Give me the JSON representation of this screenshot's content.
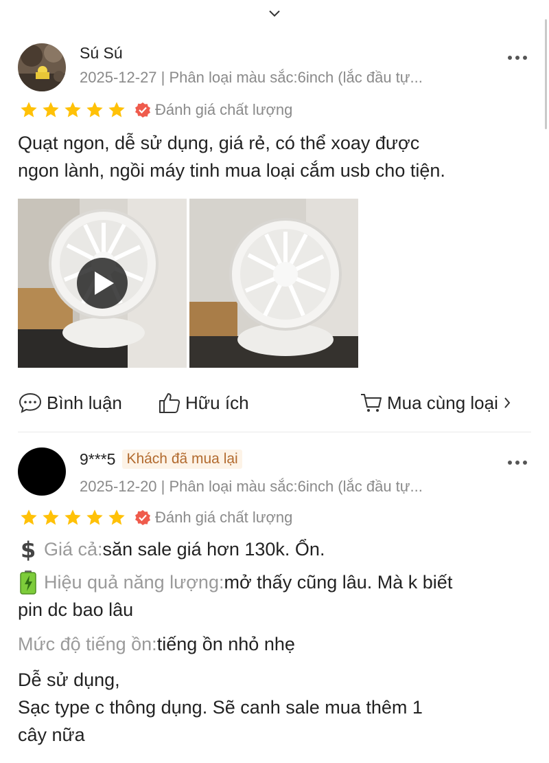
{
  "header": {
    "collapse_icon": "chevron-down-icon"
  },
  "reviews": [
    {
      "user": "Sú Sú",
      "date_variant": "2025-12-27 | Phân loại màu sắc:6inch (lắc đầu tự...",
      "stars": 5,
      "quality_badge": "Đánh giá chất lượng",
      "text_lines": [
        "Quạt ngon, dễ sử dụng, giá rẻ, có thể xoay được",
        "ngon lành, ngồi máy tinh mua loại cắm usb cho tiện."
      ],
      "media": [
        {
          "kind": "video",
          "icon": "play-icon"
        },
        {
          "kind": "photo"
        }
      ],
      "actions": {
        "comment": "Bình luận",
        "helpful": "Hữu ích",
        "buy_same": "Mua cùng loại"
      }
    },
    {
      "user": "9***5",
      "badge": "Khách đã mua lại",
      "date_variant": "2025-12-20 | Phân loại màu sắc:6inch (lắc đầu tự...",
      "stars": 5,
      "quality_badge": "Đánh giá chất lượng",
      "attributes": [
        {
          "icon": "dollar-icon",
          "label": "Giá cả:",
          "value": "săn sale giá hơn 130k. Ổn."
        },
        {
          "icon": "battery-icon",
          "label": "Hiệu quả năng lượng:",
          "value": "mở thấy cũng lâu. Mà k biết",
          "value_cont": "pin dc bao lâu"
        },
        {
          "label": "Mức độ tiếng ồn:",
          "value": "tiếng ồn nhỏ nhẹ"
        }
      ],
      "text_lines": [
        "Dễ sử dụng,",
        "Sạc type c thông dụng.  Sẽ canh sale mua thêm 1",
        "cây nữa"
      ]
    }
  ],
  "colors": {
    "star": "#ffc107",
    "verify_badge": "#ef5b4c",
    "meta_text": "#8a8a8a"
  }
}
